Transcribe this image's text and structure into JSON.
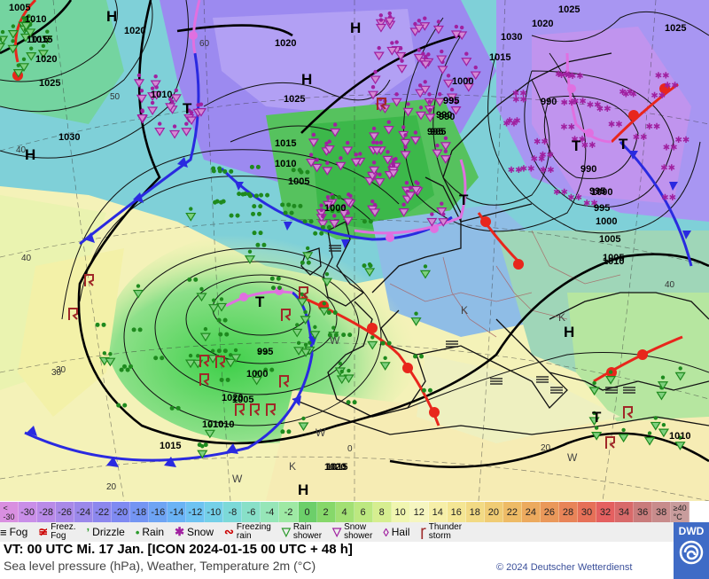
{
  "map": {
    "pressure_labels": [
      "1005",
      "1010",
      "1015",
      "1020",
      "1025",
      "1020",
      "1020",
      "1025",
      "1030",
      "1010",
      "1015",
      "1020",
      "1025",
      "1030",
      "1015",
      "1010",
      "1005",
      "1000",
      "995",
      "990",
      "985",
      "1000",
      "995",
      "990",
      "985",
      "995",
      "1000",
      "1005",
      "1010",
      "1015",
      "1020",
      "1025",
      "990",
      "995",
      "1000",
      "1005",
      "1010",
      "1015",
      "990",
      "995",
      "1000",
      "1005",
      "1010",
      "1015",
      "1020",
      "1010"
    ],
    "centers_H": [
      "H",
      "H",
      "H",
      "H",
      "H",
      "H"
    ],
    "centers_T": [
      "T",
      "T",
      "T",
      "T",
      "T",
      "T"
    ],
    "temp_labels": [
      "60",
      "50",
      "40",
      "40",
      "30",
      "30",
      "20",
      "20",
      "0",
      "40"
    ],
    "other_marks": [
      "W",
      "W",
      "K",
      "K",
      "W",
      "K",
      "W"
    ]
  },
  "scale": {
    "labels": [
      "<\n-30",
      "-30",
      "-28",
      "-26",
      "-24",
      "-22",
      "-20",
      "-18",
      "-16",
      "-14",
      "-12",
      "-10",
      "-8",
      "-6",
      "-4",
      "-2",
      "0",
      "2",
      "4",
      "6",
      "8",
      "10",
      "12",
      "14",
      "16",
      "18",
      "20",
      "22",
      "24",
      "26",
      "28",
      "30",
      "32",
      "34",
      "36",
      "38",
      "≥40\n°C"
    ],
    "colors": [
      "#d98fe0",
      "#c98ee8",
      "#b98ae8",
      "#a989e8",
      "#9b88ea",
      "#8c87ee",
      "#7f8af2",
      "#7495f3",
      "#6ea4f4",
      "#6ab3f5",
      "#6ec3f2",
      "#74d0e8",
      "#7cd9d8",
      "#88e0c8",
      "#96e6b8",
      "#9ee9a4",
      "#6ccf6a",
      "#86d86a",
      "#a2e074",
      "#bce880",
      "#d6ee90",
      "#f0f6b0",
      "#f6f6c0",
      "#f6efa8",
      "#f4e694",
      "#f2da84",
      "#f0cc74",
      "#eebb66",
      "#ecaa5e",
      "#ea985a",
      "#e88458",
      "#e67058",
      "#e46060",
      "#d86a6a",
      "#c97c7c",
      "#c88c8c",
      "#c89c9c"
    ]
  },
  "legend": {
    "fog": "Fog",
    "freezing_fog_1": "Freez.",
    "freezing_fog_2": "Fog",
    "drizzle": "Drizzle",
    "rain": "Rain",
    "snow": "Snow",
    "freezing_rain_1": "Freezing",
    "freezing_rain_2": "rain",
    "rain_shower_1": "Rain",
    "rain_shower_2": "shower",
    "snow_shower_1": "Snow",
    "snow_shower_2": "shower",
    "hail": "Hail",
    "thunderstorm_1": "Thunder",
    "thunderstorm_2": "storm"
  },
  "footer": {
    "line1": "VT: 00 UTC Mi.   17 Jan. [ICON 2024-01-15  00 UTC + 48 h]",
    "line2": "Sea level pressure (hPa), Weather, Temperature 2m (°C)",
    "copyright": "© 2024 Deutscher Wetterdienst",
    "logo_text": "DWD"
  },
  "colors": {
    "warm_front": "#e8261c",
    "cold_front": "#2a2ae0",
    "occlusion": "#e070e0",
    "isobar": "#000000"
  }
}
